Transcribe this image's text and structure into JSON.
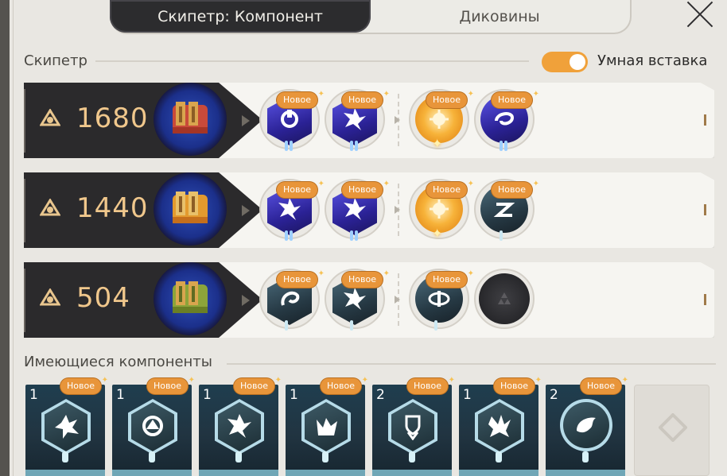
{
  "tabs": [
    {
      "label": "Скипетр: Компонент",
      "active": true
    },
    {
      "label": "Диковины",
      "active": false
    }
  ],
  "section": {
    "title": "Скипетр",
    "smart_insert": {
      "label": "Умная вставка",
      "enabled": true
    }
  },
  "rows": [
    {
      "value": "1680",
      "scepter_color": "red",
      "slots": [
        {
          "badge": "Новое",
          "style": "purple",
          "pip": "double"
        },
        {
          "badge": "Новое",
          "style": "purple",
          "pip": "double"
        },
        {
          "badge": "Новое",
          "style": "gold",
          "pip": "star"
        },
        {
          "badge": "Новое",
          "style": "purple-round",
          "pip": "double"
        }
      ]
    },
    {
      "value": "1440",
      "scepter_color": "orange",
      "slots": [
        {
          "badge": "Новое",
          "style": "purple",
          "pip": "double"
        },
        {
          "badge": "Новое",
          "style": "purple",
          "pip": "double"
        },
        {
          "badge": "Новое",
          "style": "gold",
          "pip": "star"
        },
        {
          "badge": "Новое",
          "style": "teal-round",
          "pip": "single"
        }
      ]
    },
    {
      "value": "504",
      "scepter_color": "green",
      "slots": [
        {
          "badge": "Новое",
          "style": "teal",
          "pip": "single"
        },
        {
          "badge": "Новое",
          "style": "teal",
          "pip": "single"
        },
        {
          "badge": "Новое",
          "style": "teal-round",
          "pip": "single"
        },
        {
          "badge": "",
          "style": "empty",
          "pip": "none"
        }
      ]
    }
  ],
  "available": {
    "title": "Имеющиеся компоненты",
    "cards": [
      {
        "count": "1",
        "badge": "Новое",
        "shape": "hex"
      },
      {
        "count": "1",
        "badge": "Новое",
        "shape": "hex"
      },
      {
        "count": "1",
        "badge": "Новое",
        "shape": "hex"
      },
      {
        "count": "1",
        "badge": "Новое",
        "shape": "hex"
      },
      {
        "count": "2",
        "badge": "Новое",
        "shape": "hex"
      },
      {
        "count": "1",
        "badge": "Новое",
        "shape": "hex"
      },
      {
        "count": "2",
        "badge": "Новое",
        "shape": "circle"
      }
    ]
  },
  "colors": {
    "accent": "#f0a13a",
    "badge": "#e8953a",
    "value_text": "#f0c78c",
    "dark_panel": "#2b2a2c"
  }
}
